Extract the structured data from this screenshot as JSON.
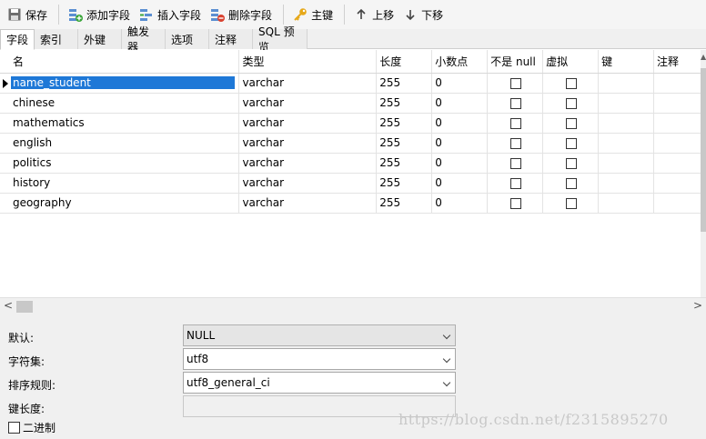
{
  "toolbar": {
    "save": "保存",
    "add_field": "添加字段",
    "insert_field": "插入字段",
    "delete_field": "删除字段",
    "primary_key": "主键",
    "move_up": "上移",
    "move_down": "下移"
  },
  "tabs": [
    "字段",
    "索引",
    "外键",
    "触发器",
    "选项",
    "注释",
    "SQL 预览"
  ],
  "columns": [
    "名",
    "类型",
    "长度",
    "小数点",
    "不是 null",
    "虚拟",
    "键",
    "注释"
  ],
  "rows": [
    {
      "name": "name_student",
      "type": "varchar",
      "length": "255",
      "decimals": "0"
    },
    {
      "name": "chinese",
      "type": "varchar",
      "length": "255",
      "decimals": "0"
    },
    {
      "name": "mathematics",
      "type": "varchar",
      "length": "255",
      "decimals": "0"
    },
    {
      "name": "english",
      "type": "varchar",
      "length": "255",
      "decimals": "0"
    },
    {
      "name": "politics",
      "type": "varchar",
      "length": "255",
      "decimals": "0"
    },
    {
      "name": "history",
      "type": "varchar",
      "length": "255",
      "decimals": "0"
    },
    {
      "name": "geography",
      "type": "varchar",
      "length": "255",
      "decimals": "0"
    }
  ],
  "props": {
    "default_label": "默认:",
    "default_value": "NULL",
    "charset_label": "字符集:",
    "charset_value": "utf8",
    "collation_label": "排序规则:",
    "collation_value": "utf8_general_ci",
    "keylen_label": "键长度:",
    "keylen_value": "",
    "binary_label": "二进制"
  },
  "watermark": "https://blog.csdn.net/f2315895270",
  "colors": {
    "selection": "#1e78d7",
    "toolbar_bg": "#f5f5f5",
    "panel_bg": "#f0f0f0"
  }
}
